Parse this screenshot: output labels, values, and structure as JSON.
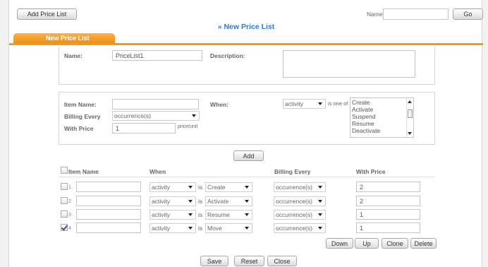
{
  "top": {
    "add_price_list_button": "Add Price List",
    "name_label": "Name:",
    "name_value": "",
    "go_button": "Go"
  },
  "page_title": "» New Price List",
  "tab_label": "New Price List",
  "form": {
    "name_label": "Name:",
    "name_value": "PriceList1",
    "description_label": "Description:",
    "description_value": ""
  },
  "item": {
    "item_name_label": "Item Name:",
    "item_name_value": "",
    "billing_every_label": "Billing Every",
    "billing_every_value": "occurrence(s)",
    "with_price_label": "With Price",
    "with_price_value": "1",
    "price_unit": "price/unit",
    "when_label": "When:",
    "when_value": "activity",
    "is_one_of": "is one of",
    "activity_options": [
      "Create",
      "Activate",
      "Suspend",
      "Resume",
      "Deactivate"
    ],
    "add_button": "Add"
  },
  "table": {
    "headers": {
      "item_name": "Item Name",
      "when": "When",
      "billing_every": "Billing Every",
      "with_price": "With Price"
    },
    "rows": [
      {
        "num": "1",
        "checked": false,
        "item_name": "",
        "when": "activity",
        "is": "is",
        "event": "Create",
        "billing": "occurrence(s)",
        "price": "2"
      },
      {
        "num": "2",
        "checked": false,
        "item_name": "",
        "when": "activity",
        "is": "is",
        "event": "Activate",
        "billing": "occurrence(s)",
        "price": "2"
      },
      {
        "num": "3",
        "checked": false,
        "item_name": "",
        "when": "activity",
        "is": "is",
        "event": "Resume",
        "billing": "occurrence(s)",
        "price": "1"
      },
      {
        "num": "4",
        "checked": true,
        "item_name": "",
        "when": "activity",
        "is": "is",
        "event": "Move",
        "billing": "occurrence(s)",
        "price": "1"
      }
    ],
    "actions": {
      "down": "Down",
      "up": "Up",
      "clone": "Clone",
      "delete": "Delete"
    }
  },
  "footer": {
    "save": "Save",
    "reset": "Reset",
    "close": "Close"
  },
  "colors": {
    "accent_orange": "#f39a1e",
    "title_blue": "#2f77c6"
  }
}
